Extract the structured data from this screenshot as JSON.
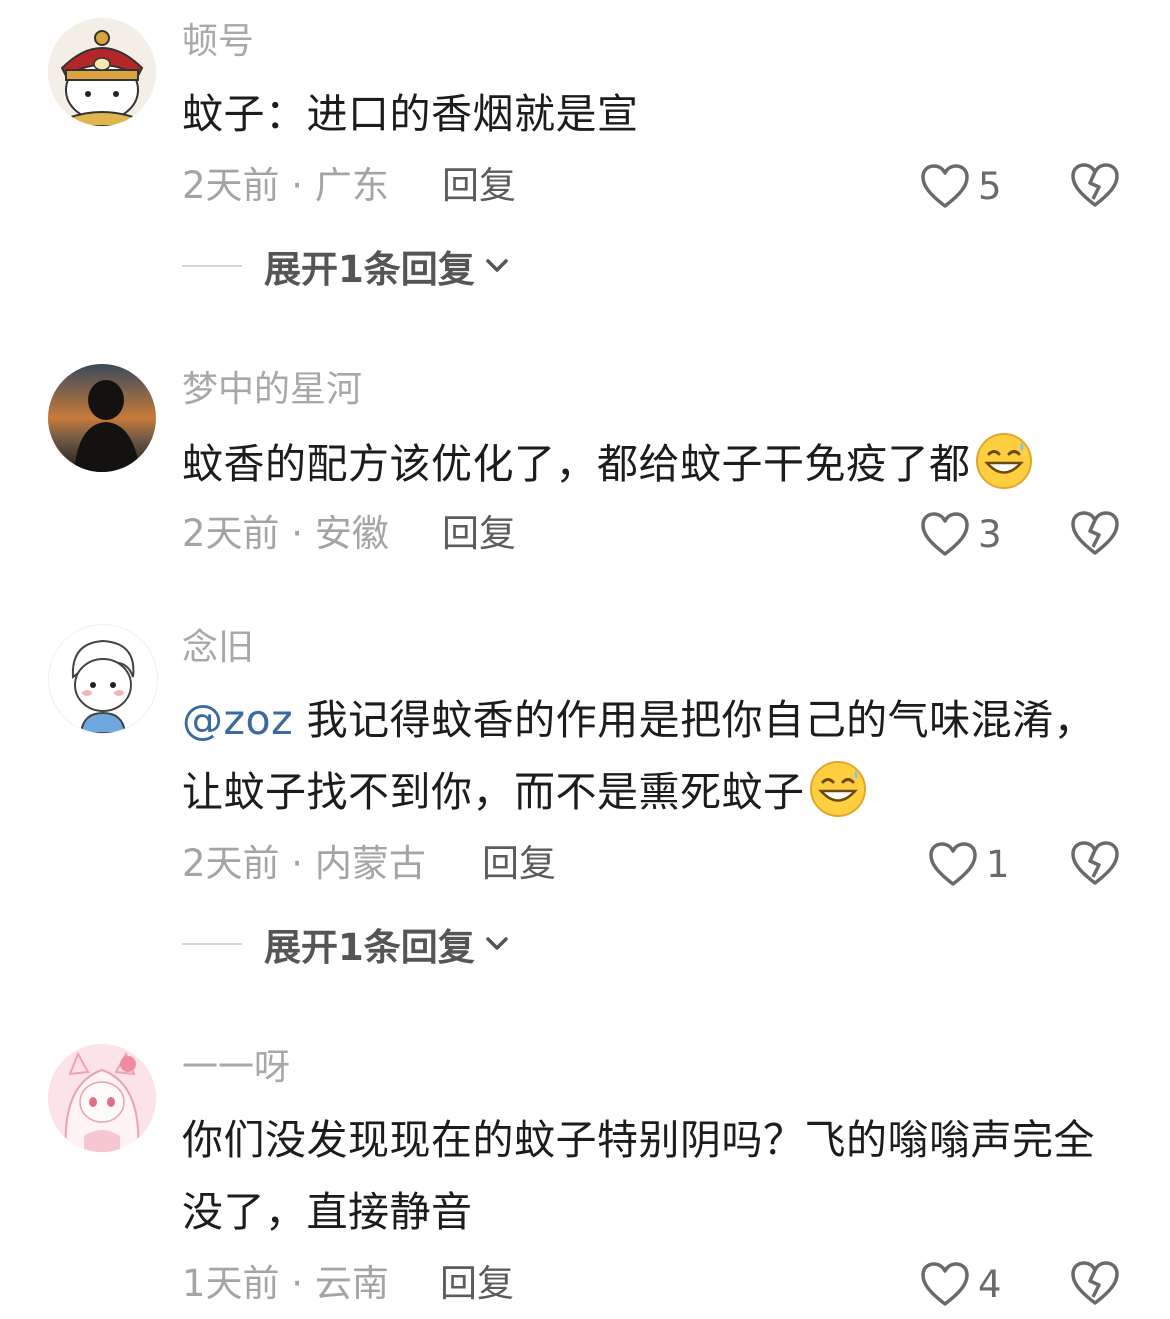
{
  "comments": [
    {
      "username": "顿号",
      "avatar": "emperor-cartoon-avatar",
      "text": "蚊子：进口的香烟就是宣",
      "time": "2天前 · 广东",
      "reply_label": "回复",
      "likes": "5",
      "expand_label": "展开1条回复"
    },
    {
      "username": "梦中的星河",
      "avatar": "silhouette-sunset-avatar",
      "text": "蚊香的配方该优化了，都给蚊子干免疫了都",
      "emoji": "grinning-sweat-emoji",
      "time": "2天前 · 安徽",
      "reply_label": "回复",
      "likes": "3"
    },
    {
      "username": "念旧",
      "avatar": "cartoon-boy-avatar",
      "mention": "@zoz",
      "text": " 我记得蚊香的作用是把你自己的气味混淆，让蚊子找不到你，而不是熏死蚊子",
      "emoji": "grinning-sweat-emoji",
      "time": "2天前 · 内蒙古",
      "reply_label": "回复",
      "likes": "1",
      "expand_label": "展开1条回复"
    },
    {
      "username": "一一呀",
      "avatar": "pink-anime-girl-avatar",
      "text": "你们没发现现在的蚊子特别阴吗？飞的嗡嗡声完全没了，直接静音",
      "time": "1天前 · 云南",
      "reply_label": "回复",
      "likes": "4"
    }
  ],
  "icons": {
    "like": "heart-outline-icon",
    "dislike": "broken-heart-icon",
    "expand": "chevron-down-icon"
  }
}
